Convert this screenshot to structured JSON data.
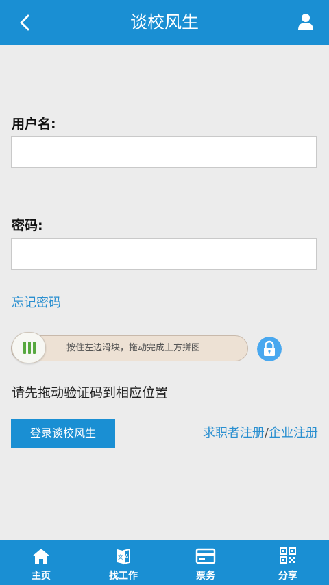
{
  "header": {
    "title": "谈校风生"
  },
  "form": {
    "username_label": "用户名:",
    "username_value": "",
    "password_label": "密码:",
    "password_value": "",
    "forgot_password": "忘记密码"
  },
  "captcha": {
    "slider_hint": "按住左边滑块，拖动完成上方拼图",
    "instruction": "请先拖动验证码到相应位置"
  },
  "actions": {
    "login_button": "登录谈校风生",
    "jobseeker_register": "求职者注册",
    "separator": "/",
    "company_register": "企业注册"
  },
  "footer": {
    "tabs": [
      {
        "label": "主页",
        "icon": "home-icon"
      },
      {
        "label": "找工作",
        "icon": "find-job-icon"
      },
      {
        "label": "票务",
        "icon": "ticket-card-icon"
      },
      {
        "label": "分享",
        "icon": "qr-code-icon"
      }
    ]
  },
  "colors": {
    "primary": "#1a8fd3",
    "link": "#2a8fd0",
    "background": "#ececec",
    "slider_track": "#ede1d4",
    "knob_bars": "#57a83f",
    "lock": "#49a8ef"
  }
}
